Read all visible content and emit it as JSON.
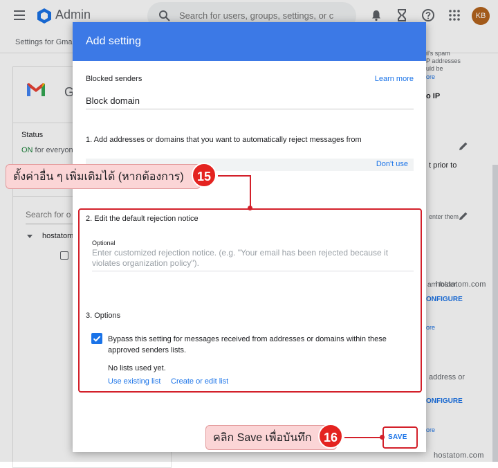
{
  "app": {
    "name": "Admin",
    "search_placeholder": "Search for users, groups, settings, or c",
    "avatar_initials": "KB"
  },
  "breadcrumb": "Settings for Gmai",
  "left_pane": {
    "app_letter": "G",
    "status_label": "Status",
    "status_on": "ON",
    "status_rest": " for everyon",
    "search_placeholder": "Search for o",
    "org_unit": "hostatom"
  },
  "right_pane": {
    "text1": "il's spam",
    "text2": "P addresses",
    "text3": "uld be",
    "more1": "ore",
    "ip": "o IP",
    "prior": "t prior to",
    "enter": "enter them",
    "spam_folder": "am folder.",
    "configure1": "ONFIGURE",
    "more2": "ore",
    "address_or": "address or",
    "configure2": "ONFIGURE",
    "more3": "ore"
  },
  "dialog": {
    "title": "Add setting",
    "blocked_senders_label": "Blocked senders",
    "learn_more": "Learn more",
    "rule_name": "Block domain",
    "step1_label": "1. Add addresses or domains that you want to automatically reject messages from",
    "dont_use": "Don't use",
    "step2_label": "2. Edit the default rejection notice",
    "optional_label": "Optional",
    "notice_placeholder": "Enter customized rejection notice. (e.g. \"Your email has been rejected because it violates organization policy\").",
    "step3_label": "3. Options",
    "bypass_label": "Bypass this setting for messages received from addresses or domains within these approved senders lists.",
    "bypass_checked": true,
    "no_lists": "No lists used yet.",
    "use_existing_list": "Use existing list",
    "create_edit_list": "Create or edit list",
    "save": "SAVE"
  },
  "annotations": {
    "callout15_text": "ตั้งค่าอื่น ๆ เพิ่มเติมได้ (หากต้องการ)",
    "callout15_num": "15",
    "callout16_text": "คลิก Save เพื่อบันทึก",
    "callout16_num": "16",
    "accent_color": "#d3202a"
  },
  "watermarks": [
    "hostatom.com",
    "hostatom.com"
  ],
  "colors": {
    "dialog_header": "#3c79e6",
    "link": "#1a73e8",
    "status_on": "#188038"
  }
}
